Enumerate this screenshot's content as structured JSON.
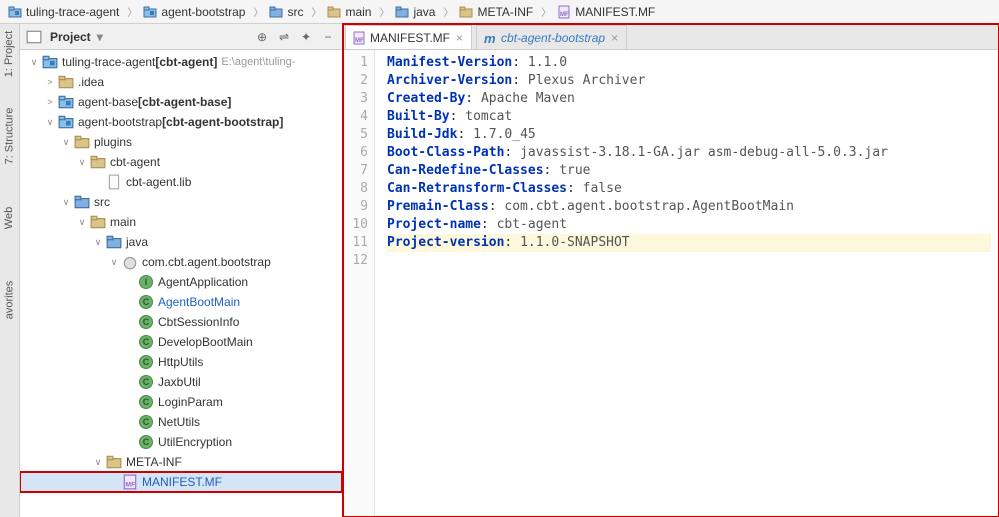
{
  "breadcrumb": [
    {
      "icon": "module",
      "label": "tuling-trace-agent"
    },
    {
      "icon": "module",
      "label": "agent-bootstrap"
    },
    {
      "icon": "folder-src",
      "label": "src"
    },
    {
      "icon": "folder",
      "label": "main"
    },
    {
      "icon": "folder-java",
      "label": "java"
    },
    {
      "icon": "folder",
      "label": "META-INF"
    },
    {
      "icon": "file-mf",
      "label": "MANIFEST.MF"
    }
  ],
  "side_tabs": {
    "project": "1: Project",
    "structure": "7: Structure",
    "web": "Web",
    "favorites": "avorites"
  },
  "project_panel": {
    "title": "Project"
  },
  "tree": [
    {
      "depth": 0,
      "arrow": "open",
      "icon": "module",
      "label": "tuling-trace-agent",
      "bold": "[cbt-agent]",
      "suffix": "E:\\agent\\tuling-"
    },
    {
      "depth": 1,
      "arrow": "closed",
      "icon": "folder",
      "label": ".idea"
    },
    {
      "depth": 1,
      "arrow": "closed",
      "icon": "module",
      "label": "agent-base",
      "bold": "[cbt-agent-base]"
    },
    {
      "depth": 1,
      "arrow": "open",
      "icon": "module",
      "label": "agent-bootstrap",
      "bold": "[cbt-agent-bootstrap]"
    },
    {
      "depth": 2,
      "arrow": "open",
      "icon": "folder",
      "label": "plugins"
    },
    {
      "depth": 3,
      "arrow": "open",
      "icon": "folder",
      "label": "cbt-agent"
    },
    {
      "depth": 4,
      "arrow": "none",
      "icon": "file",
      "label": "cbt-agent.lib"
    },
    {
      "depth": 2,
      "arrow": "open",
      "icon": "folder-src",
      "label": "src"
    },
    {
      "depth": 3,
      "arrow": "open",
      "icon": "folder",
      "label": "main"
    },
    {
      "depth": 4,
      "arrow": "open",
      "icon": "folder-java",
      "label": "java"
    },
    {
      "depth": 5,
      "arrow": "open",
      "icon": "package",
      "label": "com.cbt.agent.bootstrap"
    },
    {
      "depth": 6,
      "arrow": "none",
      "icon": "class-i",
      "label": "AgentApplication"
    },
    {
      "depth": 6,
      "arrow": "none",
      "icon": "class-c",
      "label": "AgentBootMain",
      "link": true
    },
    {
      "depth": 6,
      "arrow": "none",
      "icon": "class-c",
      "label": "CbtSessionInfo"
    },
    {
      "depth": 6,
      "arrow": "none",
      "icon": "class-c",
      "label": "DevelopBootMain"
    },
    {
      "depth": 6,
      "arrow": "none",
      "icon": "class-c",
      "label": "HttpUtils"
    },
    {
      "depth": 6,
      "arrow": "none",
      "icon": "class-c",
      "label": "JaxbUtil"
    },
    {
      "depth": 6,
      "arrow": "none",
      "icon": "class-c",
      "label": "LoginParam"
    },
    {
      "depth": 6,
      "arrow": "none",
      "icon": "class-c",
      "label": "NetUtils"
    },
    {
      "depth": 6,
      "arrow": "none",
      "icon": "class-c",
      "label": "UtilEncryption"
    },
    {
      "depth": 4,
      "arrow": "open",
      "icon": "folder",
      "label": "META-INF"
    },
    {
      "depth": 5,
      "arrow": "none",
      "icon": "file-mf",
      "label": "MANIFEST.MF",
      "link": true,
      "selected": true
    }
  ],
  "editor_tabs": [
    {
      "icon": "file-mf",
      "label": "MANIFEST.MF",
      "active": true
    },
    {
      "icon": "maven",
      "label": "cbt-agent-bootstrap",
      "active": false
    }
  ],
  "code_lines": [
    {
      "n": 1,
      "key": "Manifest-Version",
      "val": "1.1.0"
    },
    {
      "n": 2,
      "key": "Archiver-Version",
      "val": "Plexus Archiver"
    },
    {
      "n": 3,
      "key": "Created-By",
      "val": "Apache Maven"
    },
    {
      "n": 4,
      "key": "Built-By",
      "val": "tomcat"
    },
    {
      "n": 5,
      "key": "Build-Jdk",
      "val": "1.7.0_45"
    },
    {
      "n": 6,
      "key": "Boot-Class-Path",
      "val": "javassist-3.18.1-GA.jar asm-debug-all-5.0.3.jar"
    },
    {
      "n": 7,
      "key": "Can-Redefine-Classes",
      "val": "true"
    },
    {
      "n": 8,
      "key": "Can-Retransform-Classes",
      "val": "false"
    },
    {
      "n": 9,
      "key": "Premain-Class",
      "val": "com.cbt.agent.bootstrap.AgentBootMain"
    },
    {
      "n": 10,
      "key": "Project-name",
      "val": "cbt-agent"
    },
    {
      "n": 11,
      "key": "Project-version",
      "val": "1.1.0-SNAPSHOT",
      "hl": true
    },
    {
      "n": 12,
      "key": "",
      "val": ""
    }
  ]
}
